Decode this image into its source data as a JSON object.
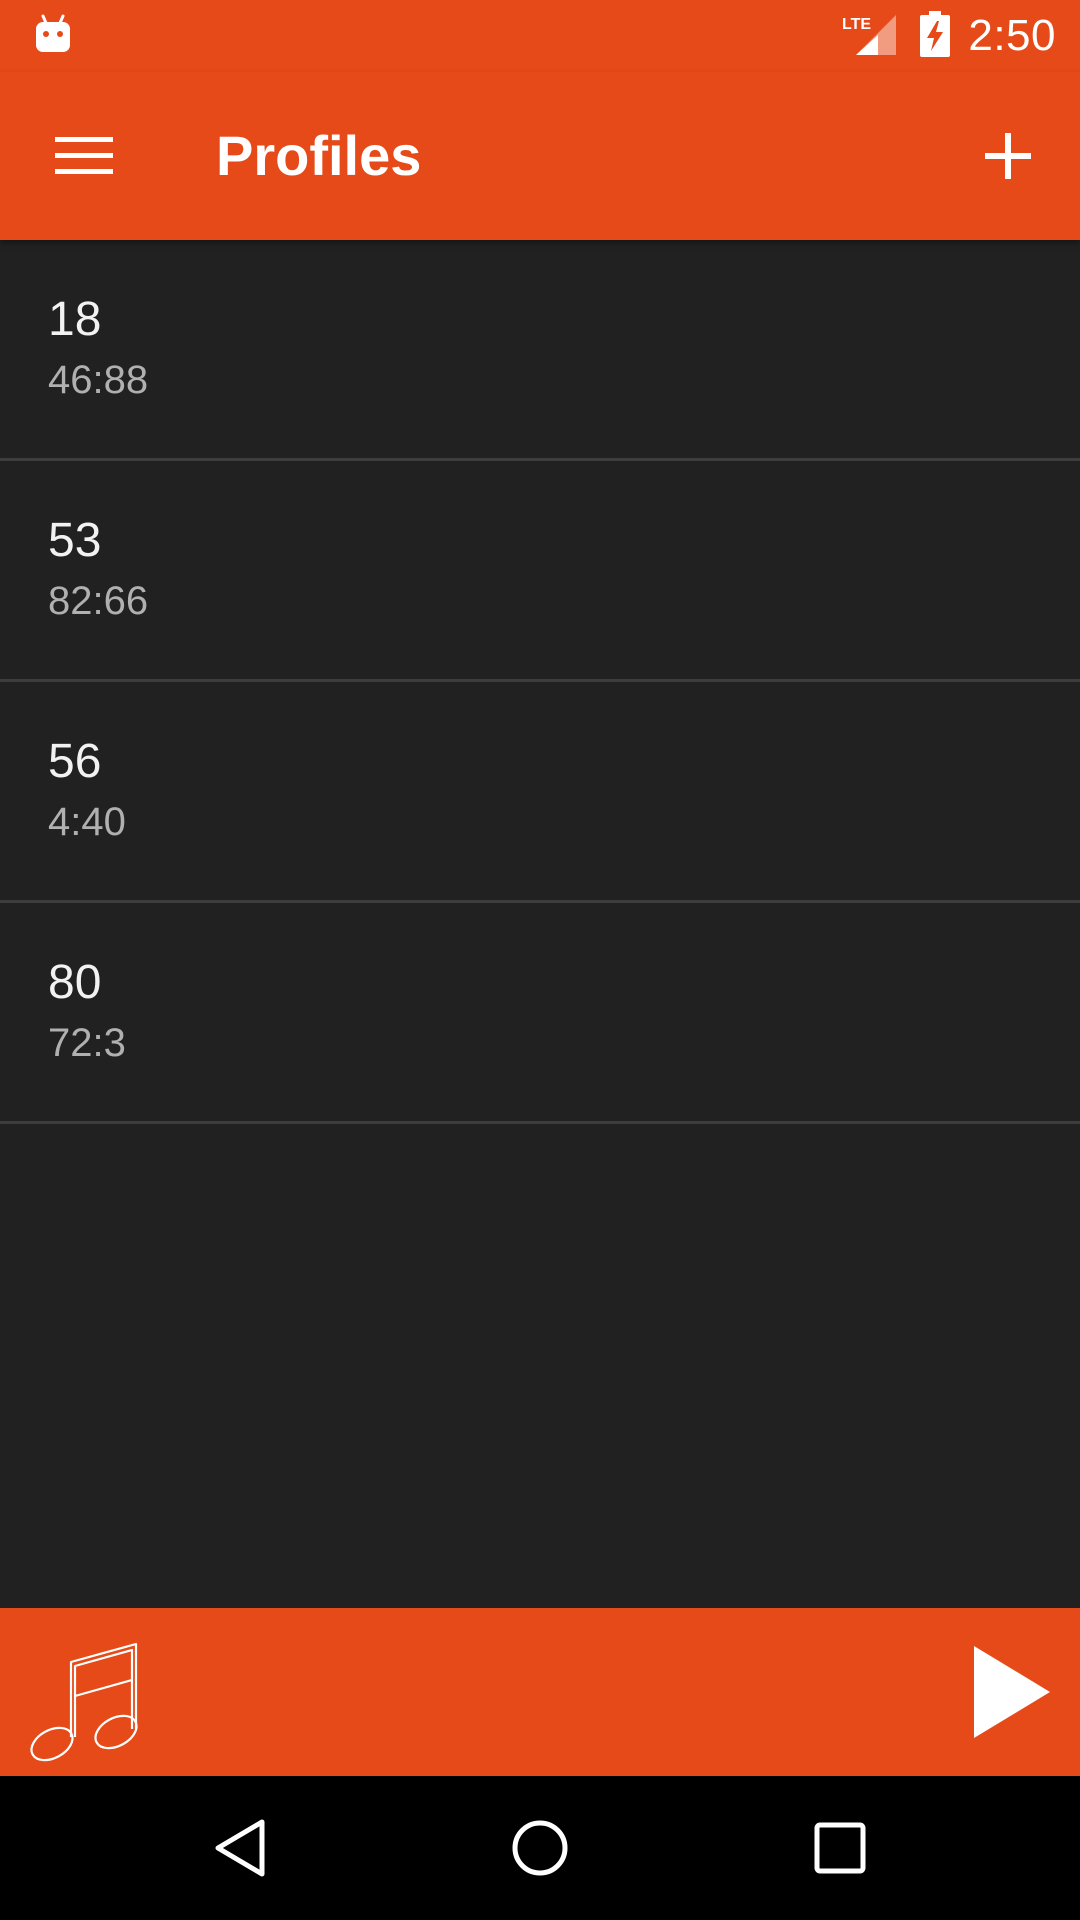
{
  "status_bar": {
    "time": "2:50",
    "network_label": "LTE",
    "icons": [
      "android-notification-icon",
      "lte-signal-icon",
      "battery-charging-icon"
    ]
  },
  "app_bar": {
    "title": "Profiles",
    "menu_icon": "hamburger-menu-icon",
    "add_icon": "plus-icon"
  },
  "profiles": [
    {
      "name": "18",
      "time": "46:88"
    },
    {
      "name": "53",
      "time": "82:66"
    },
    {
      "name": "56",
      "time": "4:40"
    },
    {
      "name": "80",
      "time": "72:3"
    }
  ],
  "player": {
    "icon": "music-note-icon",
    "play_icon": "play-icon"
  },
  "nav_bar": {
    "back_icon": "back-icon",
    "home_icon": "home-icon",
    "recents_icon": "recents-icon"
  },
  "colors": {
    "accent": "#e64a19",
    "background": "#212121",
    "divider": "#3d3d3d",
    "primary_text": "#f2f2f2",
    "secondary_text": "#b0b0b0"
  }
}
